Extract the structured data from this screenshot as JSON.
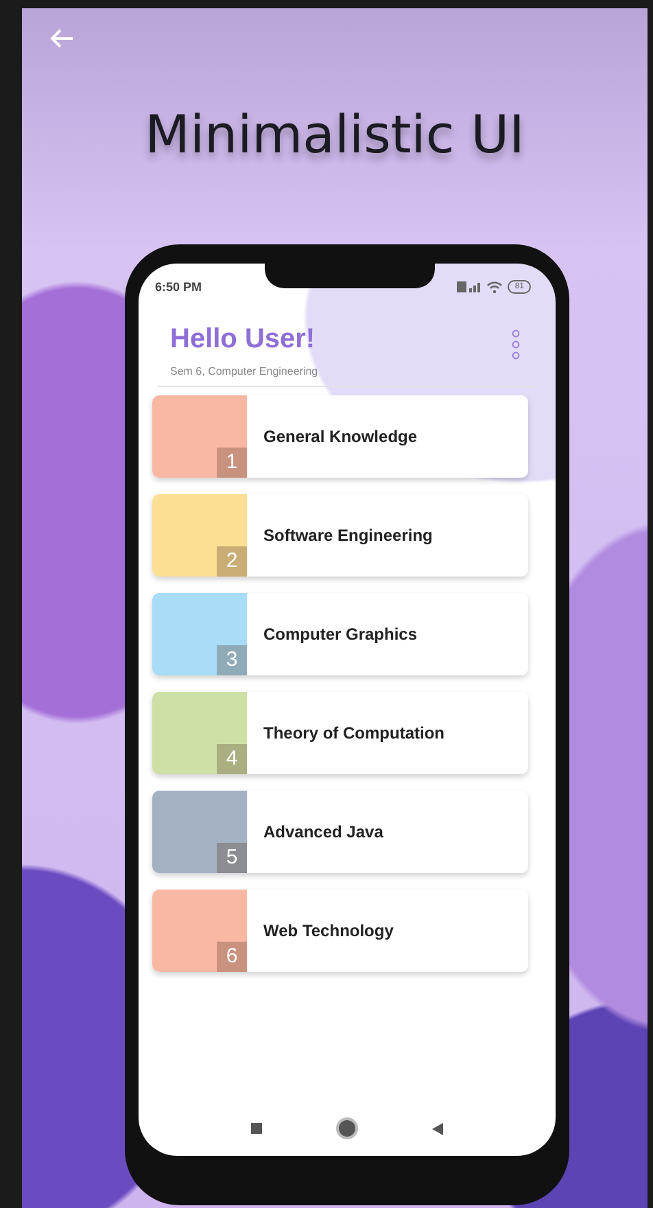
{
  "title": "Minimalistic UI",
  "phone": {
    "status_bar": {
      "time": "6:50 PM",
      "battery": "81"
    },
    "greeting": "Hello User!",
    "subtitle": "Sem 6, Computer Engineering",
    "subjects": [
      {
        "number": "1",
        "name": "General Knowledge",
        "color": "#f9b8a4"
      },
      {
        "number": "2",
        "name": "Software Engineering",
        "color": "#fbdf95"
      },
      {
        "number": "3",
        "name": "Computer Graphics",
        "color": "#a8dcf7"
      },
      {
        "number": "4",
        "name": "Theory of Computation",
        "color": "#cfe0a6"
      },
      {
        "number": "5",
        "name": "Advanced Java",
        "color": "#a3b1c2"
      },
      {
        "number": "6",
        "name": "Web Technology",
        "color": "#f9b8a4"
      }
    ]
  }
}
